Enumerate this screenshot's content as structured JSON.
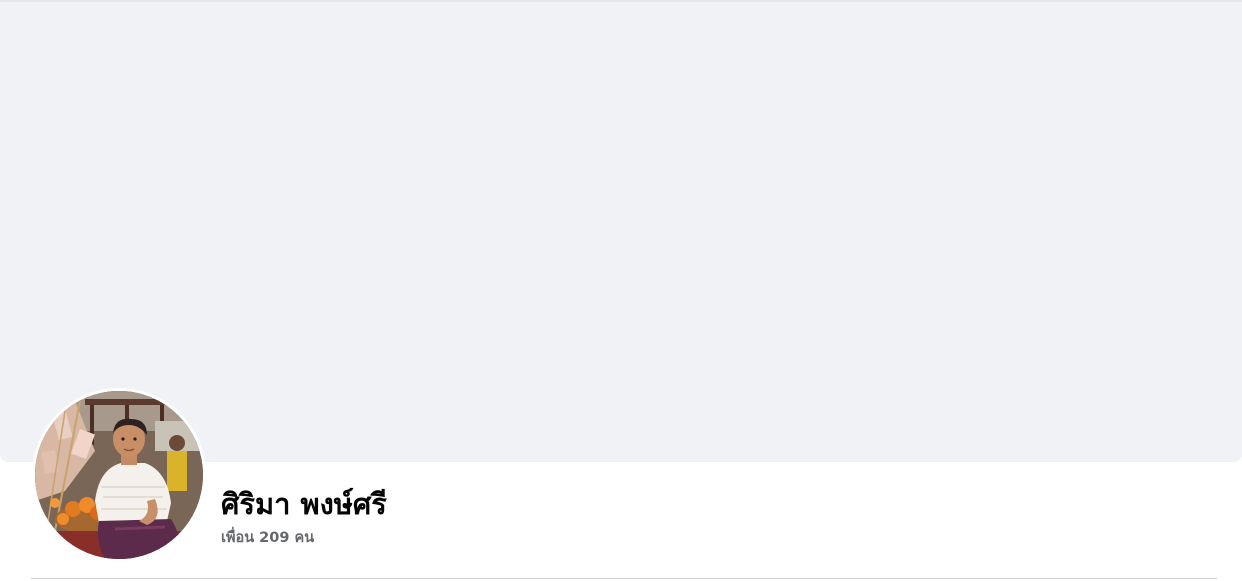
{
  "profile": {
    "name": "ศิริมา พงษ์ศรี",
    "friends_text": "เพื่อน 209 คน"
  },
  "colors": {
    "cover_bg": "#f0f2f5",
    "name_text": "#050505",
    "secondary_text": "#65676b",
    "divider": "#ced0d4"
  },
  "icons": {
    "avatar": "profile-photo"
  }
}
